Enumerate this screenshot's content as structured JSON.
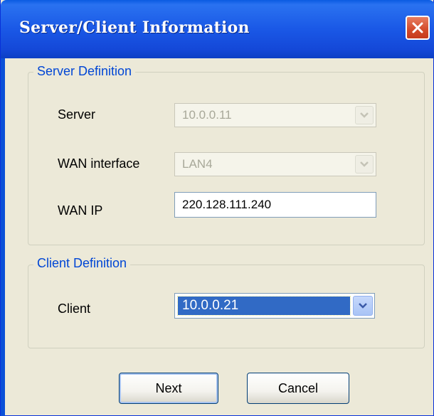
{
  "window": {
    "title": "Server/Client Information"
  },
  "server_group": {
    "legend": "Server Definition",
    "server_label": "Server",
    "server_value": "10.0.0.11",
    "wan_interface_label": "WAN interface",
    "wan_interface_value": "LAN4",
    "wan_ip_label": "WAN IP",
    "wan_ip_value": "220.128.111.240"
  },
  "client_group": {
    "legend": "Client Definition",
    "client_label": "Client",
    "client_value": "10.0.0.21"
  },
  "buttons": {
    "next": "Next",
    "cancel": "Cancel"
  },
  "icons": {
    "close": "close-icon",
    "dropdown": "chevron-down-icon"
  },
  "colors": {
    "titlebar": "#1a58e6",
    "legend_text": "#0046d5",
    "selection": "#316ac5",
    "window_bg": "#ece9d8"
  }
}
